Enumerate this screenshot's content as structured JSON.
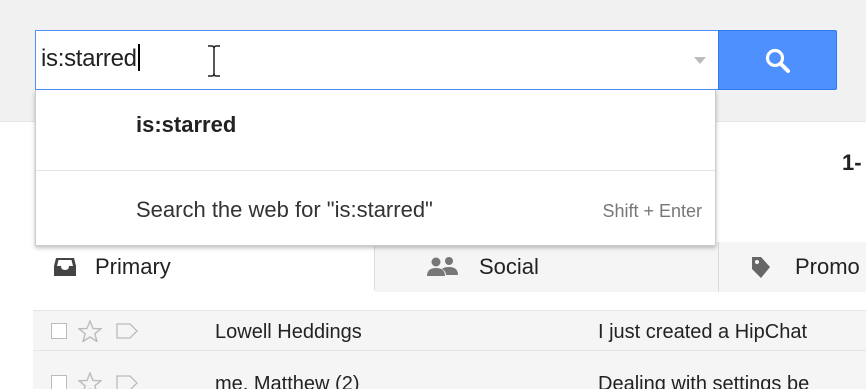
{
  "search": {
    "query": "is:starred",
    "button_icon": "search-icon"
  },
  "autocomplete": {
    "suggestion": "is:starred",
    "web_search_label": "Search the web for \"is:starred\"",
    "web_search_hint": "Shift + Enter"
  },
  "pagination": {
    "partial_text": "1-"
  },
  "tabs": [
    {
      "label": "Primary",
      "icon": "inbox-icon"
    },
    {
      "label": "Social",
      "icon": "people-icon"
    },
    {
      "label": "Promo",
      "icon": "tag-icon"
    }
  ],
  "messages": [
    {
      "sender": "Lowell Heddings",
      "subject": "I just created a HipChat"
    },
    {
      "sender": "me, Matthew (2)",
      "subject": "Dealing with settings be"
    }
  ],
  "colors": {
    "accent": "#4d90fe",
    "header_bg": "#f1f1f1"
  }
}
